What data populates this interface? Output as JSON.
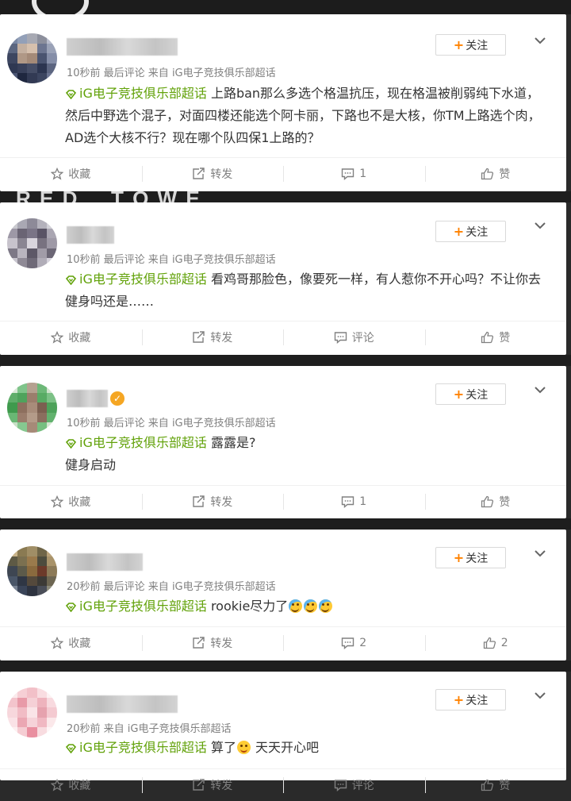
{
  "posts": [
    {
      "follow_label": "关注",
      "meta": "10秒前  最后评论  来自 iG电子竞技俱乐部超话",
      "topic": "iG电子竞技俱乐部超话",
      "text": " 上路ban那么多选个格温抗压，现在格温被削弱纯下水道，然后中野选个混子，对面四楼还能选个阿卡丽，下路也不是大核，你TM上路选个肉，AD选个大核不行？现在哪个队四保1上路的？",
      "actions": {
        "collect": "收藏",
        "repost": "转发",
        "comment": "1",
        "like": "赞"
      }
    },
    {
      "follow_label": "关注",
      "meta": "10秒前  最后评论  来自 iG电子竞技俱乐部超话",
      "topic": "iG电子竞技俱乐部超话",
      "text": " 看鸡哥那脸色，像要死一样，有人惹你不开心吗？不让你去健身吗还是……",
      "actions": {
        "collect": "收藏",
        "repost": "转发",
        "comment": "评论",
        "like": "赞"
      }
    },
    {
      "follow_label": "关注",
      "meta": "10秒前  最后评论  来自 iG电子竞技俱乐部超话",
      "topic": "iG电子竞技俱乐部超话",
      "text_line1": " 露露是?",
      "text_line2": "健身启动",
      "actions": {
        "collect": "收藏",
        "repost": "转发",
        "comment": "1",
        "like": "赞"
      }
    },
    {
      "follow_label": "关注",
      "meta": "20秒前  最后评论  来自 iG电子竞技俱乐部超话",
      "topic": "iG电子竞技俱乐部超话",
      "text": " rookie尽力了",
      "emoji_icon": "crying-emoji-icon",
      "actions": {
        "collect": "收藏",
        "repost": "转发",
        "comment": "2",
        "like": "2"
      }
    },
    {
      "follow_label": "关注",
      "meta": "20秒前  来自 iG电子竞技俱乐部超话",
      "topic": "iG电子竞技俱乐部超话",
      "text_a": " 算了",
      "emoji_icon": "happy-emoji-icon",
      "text_b": " 天天开心吧",
      "actions": {
        "collect": "收藏",
        "repost": "转发",
        "comment": "评论",
        "like": "赞"
      }
    }
  ],
  "colors": {
    "topic": "#62a20a",
    "follow_plus": "#ff8200",
    "meta": "#808080",
    "verified": "#f5a623"
  }
}
